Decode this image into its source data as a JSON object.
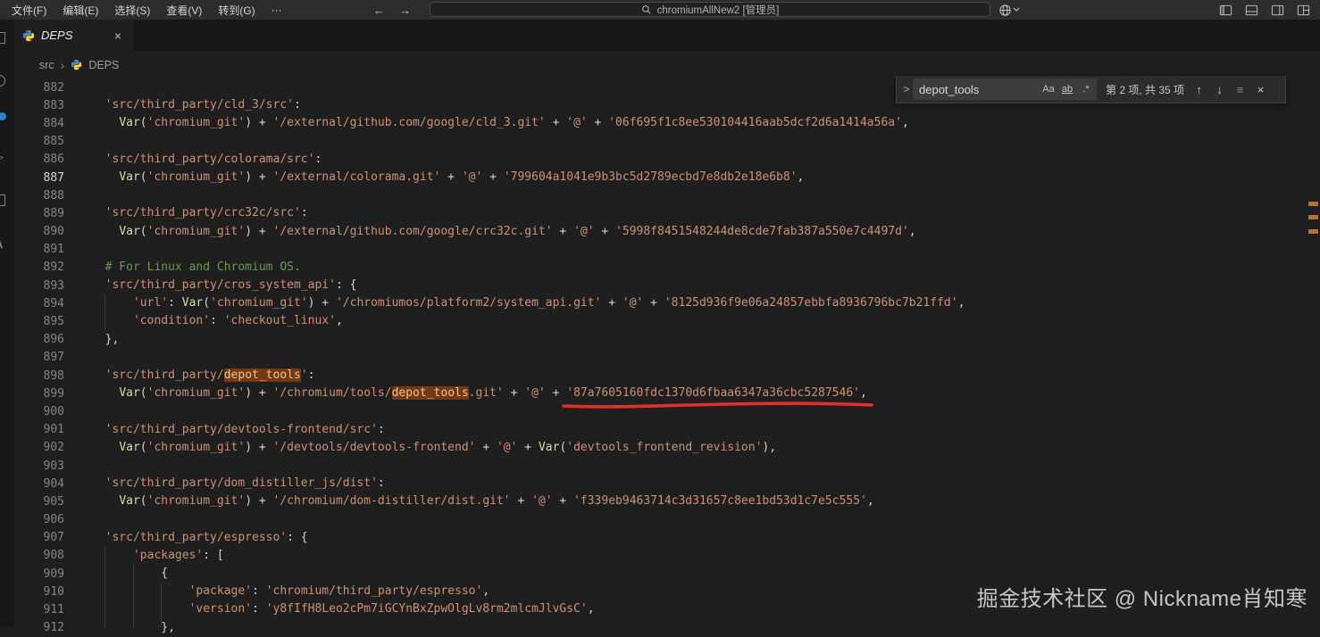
{
  "titlebar": {
    "menus": [
      {
        "id": "file",
        "label": "文件(F)"
      },
      {
        "id": "edit",
        "label": "编辑(E)"
      },
      {
        "id": "selection",
        "label": "选择(S)"
      },
      {
        "id": "view",
        "label": "查看(V)"
      },
      {
        "id": "goto",
        "label": "转到(G)"
      },
      {
        "id": "more",
        "label": "···"
      }
    ],
    "back": "←",
    "forward": "→",
    "command_center": "chromiumAllNew2 [管理员]"
  },
  "tab": {
    "label": "DEPS",
    "close": "×"
  },
  "breadcrumb": {
    "root": "src",
    "sep": "›",
    "file": "DEPS"
  },
  "find": {
    "expand": ">",
    "query": "depot_tools",
    "toggles": [
      {
        "name": "match-case",
        "label": "Aa"
      },
      {
        "name": "whole-word",
        "label": "ab"
      },
      {
        "name": "regex",
        "label": ".*"
      }
    ],
    "results": "第 2 项, 共 35 项",
    "prev": "↑",
    "next": "↓",
    "in_selection": "≡",
    "close": "×"
  },
  "code": {
    "language": "python",
    "file": "DEPS",
    "lines": [
      {
        "n": "882",
        "t": []
      },
      {
        "n": "883",
        "t": [
          [
            "s",
            "  'src/third_party/cld_3/src'"
          ],
          [
            "p",
            ":"
          ]
        ]
      },
      {
        "n": "884",
        "t": [
          [
            "p",
            "    "
          ],
          [
            "f",
            "Var"
          ],
          [
            "p",
            "("
          ],
          [
            "s",
            "'chromium_git'"
          ],
          [
            "p",
            ") + "
          ],
          [
            "s",
            "'/external/github.com/google/cld_3.git'"
          ],
          [
            "p",
            " + "
          ],
          [
            "s",
            "'@'"
          ],
          [
            "p",
            " + "
          ],
          [
            "s",
            "'06f695f1c8ee530104416aab5dcf2d6a1414a56a'"
          ],
          [
            "p",
            ","
          ]
        ]
      },
      {
        "n": "885",
        "t": []
      },
      {
        "n": "886",
        "t": [
          [
            "s",
            "  'src/third_party/colorama/src'"
          ],
          [
            "p",
            ":"
          ]
        ]
      },
      {
        "n": "887",
        "cur": true,
        "t": [
          [
            "p",
            "    "
          ],
          [
            "f",
            "Var"
          ],
          [
            "p",
            "("
          ],
          [
            "s",
            "'chromium_git'"
          ],
          [
            "p",
            ") + "
          ],
          [
            "s",
            "'/external/colorama.git'"
          ],
          [
            "p",
            " + "
          ],
          [
            "s",
            "'@'"
          ],
          [
            "p",
            " + "
          ],
          [
            "s",
            "'799604a1041e9b3bc5d2789ecbd7e8db2e18e6b8'"
          ],
          [
            "p",
            ","
          ]
        ]
      },
      {
        "n": "888",
        "t": []
      },
      {
        "n": "889",
        "t": [
          [
            "s",
            "  'src/third_party/crc32c/src'"
          ],
          [
            "p",
            ":"
          ]
        ]
      },
      {
        "n": "890",
        "t": [
          [
            "p",
            "    "
          ],
          [
            "f",
            "Var"
          ],
          [
            "p",
            "("
          ],
          [
            "s",
            "'chromium_git'"
          ],
          [
            "p",
            ") + "
          ],
          [
            "s",
            "'/external/github.com/google/crc32c.git'"
          ],
          [
            "p",
            " + "
          ],
          [
            "s",
            "'@'"
          ],
          [
            "p",
            " + "
          ],
          [
            "s",
            "'5998f8451548244de8cde7fab387a550e7c4497d'"
          ],
          [
            "p",
            ","
          ]
        ]
      },
      {
        "n": "891",
        "t": []
      },
      {
        "n": "892",
        "t": [
          [
            "c",
            "  # For Linux and Chromium OS."
          ]
        ]
      },
      {
        "n": "893",
        "t": [
          [
            "s",
            "  'src/third_party/cros_system_api'"
          ],
          [
            "p",
            ": {"
          ]
        ]
      },
      {
        "n": "894",
        "t": [
          [
            "p",
            "      "
          ],
          [
            "s",
            "'url'"
          ],
          [
            "p",
            ": "
          ],
          [
            "f",
            "Var"
          ],
          [
            "p",
            "("
          ],
          [
            "s",
            "'chromium_git'"
          ],
          [
            "p",
            ") + "
          ],
          [
            "s",
            "'/chromiumos/platform2/system_api.git'"
          ],
          [
            "p",
            " + "
          ],
          [
            "s",
            "'@'"
          ],
          [
            "p",
            " + "
          ],
          [
            "s",
            "'8125d936f9e06a24857ebbfa8936796bc7b21ffd'"
          ],
          [
            "p",
            ","
          ]
        ]
      },
      {
        "n": "895",
        "t": [
          [
            "p",
            "      "
          ],
          [
            "s",
            "'condition'"
          ],
          [
            "p",
            ": "
          ],
          [
            "s",
            "'checkout_linux'"
          ],
          [
            "p",
            ","
          ]
        ]
      },
      {
        "n": "896",
        "t": [
          [
            "p",
            "  },"
          ]
        ]
      },
      {
        "n": "897",
        "t": []
      },
      {
        "n": "898",
        "t": [
          [
            "s",
            "  'src/third_party/"
          ],
          [
            "m",
            "depot_tools"
          ],
          [
            "s",
            "'"
          ],
          [
            "p",
            ":"
          ]
        ]
      },
      {
        "n": "899",
        "t": [
          [
            "p",
            "    "
          ],
          [
            "f",
            "Var"
          ],
          [
            "p",
            "("
          ],
          [
            "s",
            "'chromium_git'"
          ],
          [
            "p",
            ") + "
          ],
          [
            "s",
            "'/chromium/tools/"
          ],
          [
            "m",
            "depot_tools"
          ],
          [
            "s",
            ".git'"
          ],
          [
            "p",
            " + "
          ],
          [
            "s",
            "'@'"
          ],
          [
            "p",
            " + "
          ],
          [
            "s",
            "'87a7605160fdc1370d6fbaa6347a36cbc5287546'"
          ],
          [
            "p",
            ","
          ]
        ]
      },
      {
        "n": "900",
        "t": []
      },
      {
        "n": "901",
        "t": [
          [
            "s",
            "  'src/third_party/devtools-frontend/src'"
          ],
          [
            "p",
            ":"
          ]
        ]
      },
      {
        "n": "902",
        "t": [
          [
            "p",
            "    "
          ],
          [
            "f",
            "Var"
          ],
          [
            "p",
            "("
          ],
          [
            "s",
            "'chromium_git'"
          ],
          [
            "p",
            ") + "
          ],
          [
            "s",
            "'/devtools/devtools-frontend'"
          ],
          [
            "p",
            " + "
          ],
          [
            "s",
            "'@'"
          ],
          [
            "p",
            " + "
          ],
          [
            "f",
            "Var"
          ],
          [
            "p",
            "("
          ],
          [
            "s",
            "'devtools_frontend_revision'"
          ],
          [
            "p",
            "),"
          ]
        ]
      },
      {
        "n": "903",
        "t": []
      },
      {
        "n": "904",
        "t": [
          [
            "s",
            "  'src/third_party/dom_distiller_js/dist'"
          ],
          [
            "p",
            ":"
          ]
        ]
      },
      {
        "n": "905",
        "t": [
          [
            "p",
            "    "
          ],
          [
            "f",
            "Var"
          ],
          [
            "p",
            "("
          ],
          [
            "s",
            "'chromium_git'"
          ],
          [
            "p",
            ") + "
          ],
          [
            "s",
            "'/chromium/dom-distiller/dist.git'"
          ],
          [
            "p",
            " + "
          ],
          [
            "s",
            "'@'"
          ],
          [
            "p",
            " + "
          ],
          [
            "s",
            "'f339eb9463714c3d31657c8ee1bd53d1c7e5c555'"
          ],
          [
            "p",
            ","
          ]
        ]
      },
      {
        "n": "906",
        "t": []
      },
      {
        "n": "907",
        "t": [
          [
            "s",
            "  'src/third_party/espresso'"
          ],
          [
            "p",
            ": {"
          ]
        ]
      },
      {
        "n": "908",
        "t": [
          [
            "p",
            "      "
          ],
          [
            "s",
            "'packages'"
          ],
          [
            "p",
            ": ["
          ]
        ]
      },
      {
        "n": "909",
        "t": [
          [
            "p",
            "          {"
          ]
        ]
      },
      {
        "n": "910",
        "t": [
          [
            "p",
            "              "
          ],
          [
            "s",
            "'package'"
          ],
          [
            "p",
            ": "
          ],
          [
            "s",
            "'chromium/third_party/espresso'"
          ],
          [
            "p",
            ","
          ]
        ]
      },
      {
        "n": "911",
        "t": [
          [
            "p",
            "              "
          ],
          [
            "s",
            "'version'"
          ],
          [
            "p",
            ": "
          ],
          [
            "s",
            "'y8fIfH8Leo2cPm7iGCYnBxZpwOlgLv8rm2mlcmJlvGsC'"
          ],
          [
            "p",
            ","
          ]
        ]
      },
      {
        "n": "912",
        "t": [
          [
            "p",
            "          },"
          ]
        ]
      }
    ]
  },
  "watermark": "掘金技术社区 @ Nickname肖知寒",
  "colors": {
    "string": "#ce9178",
    "function": "#dcdcaa",
    "comment": "#6a9955",
    "match_highlight": "#ea5c00",
    "annotation_red": "#e0312b",
    "badge_blue": "#2f81d6"
  }
}
